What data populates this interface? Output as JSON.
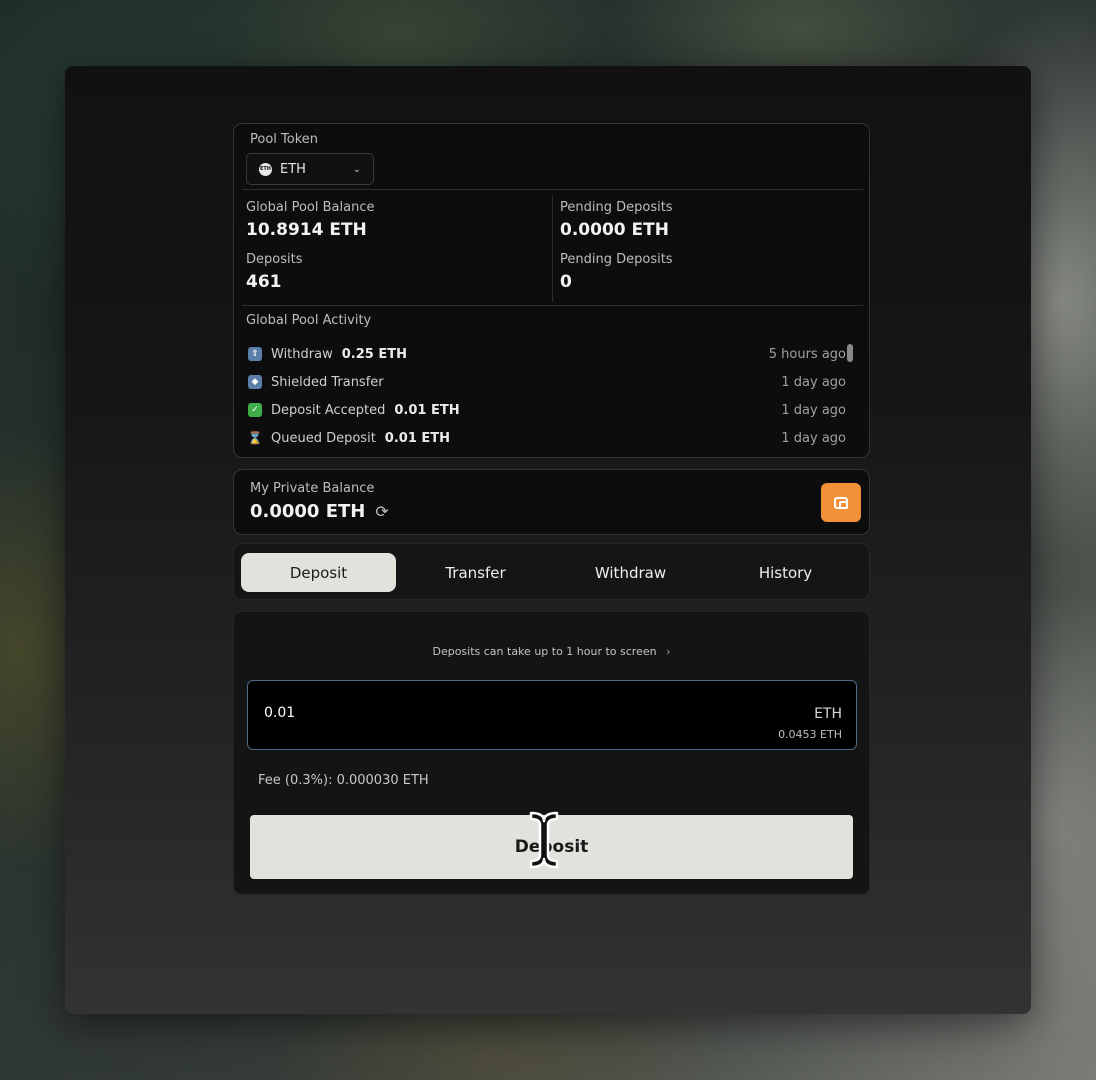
{
  "pool": {
    "token_label": "Pool Token",
    "token_value": "ETH",
    "global_balance_label": "Global Pool Balance",
    "global_balance_value": "10.8914 ETH",
    "pending_deposits_label": "Pending Deposits",
    "pending_deposits_value": "0.0000 ETH",
    "deposits_label": "Deposits",
    "deposits_value": "461",
    "pending_count_label": "Pending Deposits",
    "pending_count_value": "0",
    "activity_label": "Global Pool Activity",
    "activity": [
      {
        "icon": "withdraw-icon",
        "type": "Withdraw",
        "amount": "0.25 ETH",
        "time": "5 hours ago",
        "color": "#5b7fa8"
      },
      {
        "icon": "shield-icon",
        "type": "Shielded Transfer",
        "amount": "",
        "time": "1 day ago",
        "color": "#5b7fa8"
      },
      {
        "icon": "check-icon",
        "type": "Deposit Accepted",
        "amount": "0.01 ETH",
        "time": "1 day ago",
        "color": "#3fae49"
      },
      {
        "icon": "hourglass-icon",
        "type": "Queued Deposit",
        "amount": "0.01 ETH",
        "time": "1 day ago",
        "color": "#8a7a55"
      }
    ]
  },
  "balance": {
    "label": "My Private Balance",
    "value": "0.0000 ETH"
  },
  "tabs": [
    "Deposit",
    "Transfer",
    "Withdraw",
    "History"
  ],
  "form": {
    "notice": "Deposits can take up to 1 hour to screen",
    "amount_value": "0.01",
    "amount_unit": "ETH",
    "available": "0.0453 ETH",
    "fee": "Fee (0.3%): 0.000030 ETH",
    "submit_label": "Deposit"
  },
  "colors": {
    "accent": "#f3913a",
    "button_bg": "#e2e1dc",
    "input_border": "#4a6a8a"
  }
}
